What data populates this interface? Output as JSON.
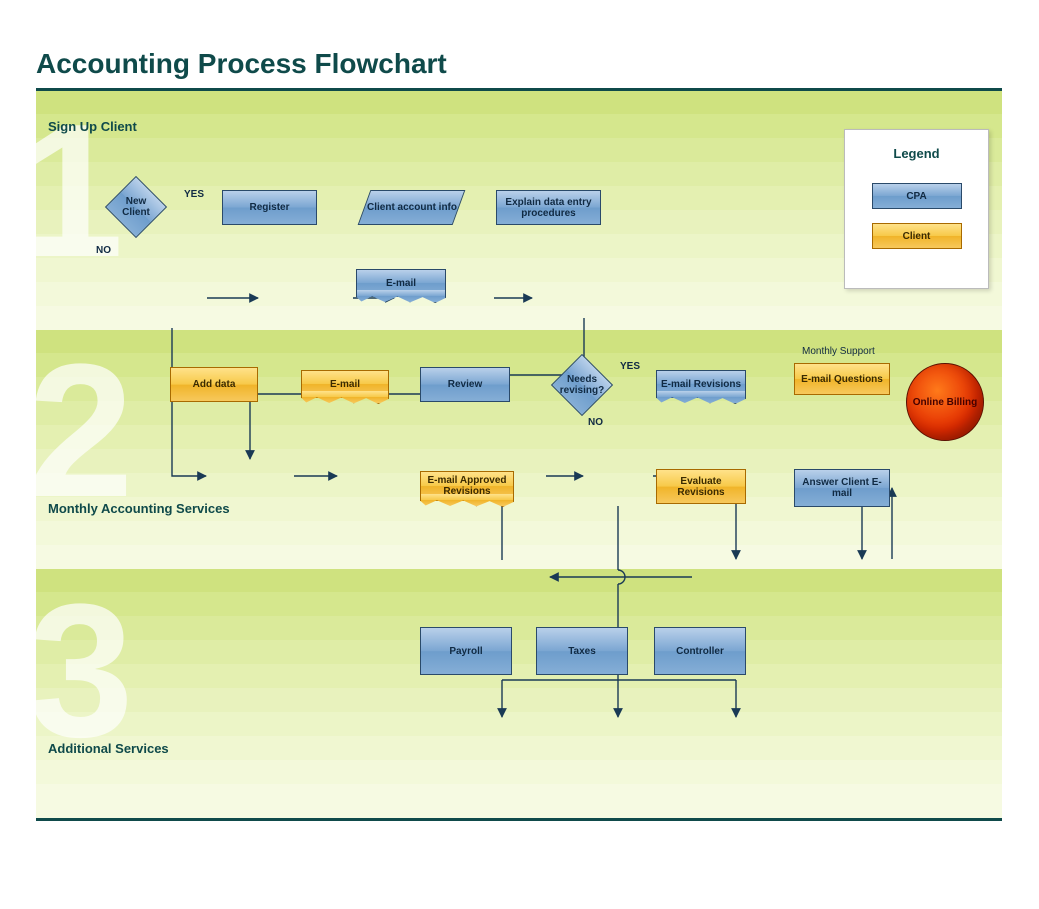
{
  "title": "Accounting Process Flowchart",
  "sections": {
    "s1": {
      "number": "1",
      "label": "Sign Up Client"
    },
    "s2": {
      "number": "2",
      "label": "Monthly Accounting Services"
    },
    "s3": {
      "number": "3",
      "label": "Additional Services"
    }
  },
  "legend": {
    "title": "Legend",
    "cpa": "CPA",
    "client": "Client"
  },
  "nodes": {
    "new_client": "New Client",
    "register": "Register",
    "account_info": "Client account info",
    "explain": "Explain data entry procedures",
    "email1": "E-mail",
    "add_data": "Add  data",
    "email2": "E-mail",
    "review": "Review",
    "needs_revising": "Needs revising?",
    "email_revisions": "E-mail Revisions",
    "evaluate_revisions": "Evaluate Revisions",
    "approved_revisions": "E-mail Approved Revisions",
    "email_questions": "E-mail Questions",
    "answer_client": "Answer Client E-mail",
    "online_billing": "Online Billing",
    "payroll": "Payroll",
    "taxes": "Taxes",
    "controller": "Controller"
  },
  "edge_labels": {
    "yes1": "YES",
    "no1": "NO",
    "yes2": "YES",
    "no2": "NO",
    "monthly_support": "Monthly Support"
  },
  "colors": {
    "cpa_fill": "#7ba6d2",
    "client_fill": "#f7c948",
    "accent": "#0f4a4a",
    "billing": "#e22b00"
  }
}
